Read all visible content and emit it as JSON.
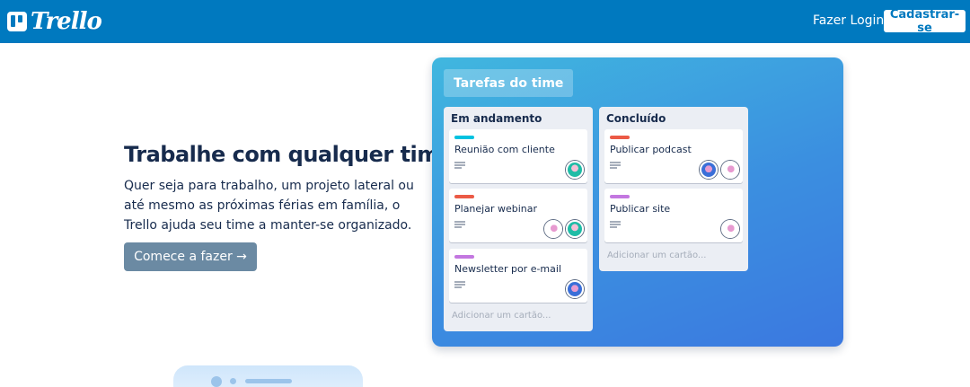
{
  "header": {
    "logo_text": "Trello",
    "login_label": "Fazer Login",
    "signup_label": "Cadastrar-se"
  },
  "hero": {
    "title": "Trabalhe com qualquer time",
    "description": "Quer seja para trabalho, um projeto lateral ou até mesmo as próximas férias em família, o Trello ajuda seu time a manter-se organizado.",
    "cta_label": "Comece a fazer →"
  },
  "board": {
    "title": "Tarefas do time",
    "lists": [
      {
        "title": "Em andamento",
        "add_card_label": "Adicionar um cartão...",
        "cards": [
          {
            "title": "Reunião com cliente",
            "label_color": "#00c2e0",
            "has_description": true,
            "avatars": [
              "teal"
            ]
          },
          {
            "title": "Planejar webinar",
            "label_color": "#eb5a46",
            "has_description": true,
            "avatars": [
              "pink",
              "teal"
            ]
          },
          {
            "title": "Newsletter por e-mail",
            "label_color": "#c377e0",
            "has_description": true,
            "avatars": [
              "pink"
            ]
          }
        ]
      },
      {
        "title": "Concluído",
        "add_card_label": "Adicionar um cartão...",
        "cards": [
          {
            "title": "Publicar podcast",
            "label_color": "#eb5a46",
            "has_description": true,
            "avatars": [
              "blue",
              "pink"
            ]
          },
          {
            "title": "Publicar site",
            "label_color": "#c377e0",
            "has_description": true,
            "avatars": [
              "pink"
            ]
          }
        ]
      }
    ]
  },
  "colors": {
    "header_bg": "#0079bf",
    "cta_bg": "#6b8aa3",
    "text_primary": "#172b4d",
    "label_cyan": "#00c2e0",
    "label_red": "#eb5a46",
    "label_purple": "#c377e0"
  }
}
